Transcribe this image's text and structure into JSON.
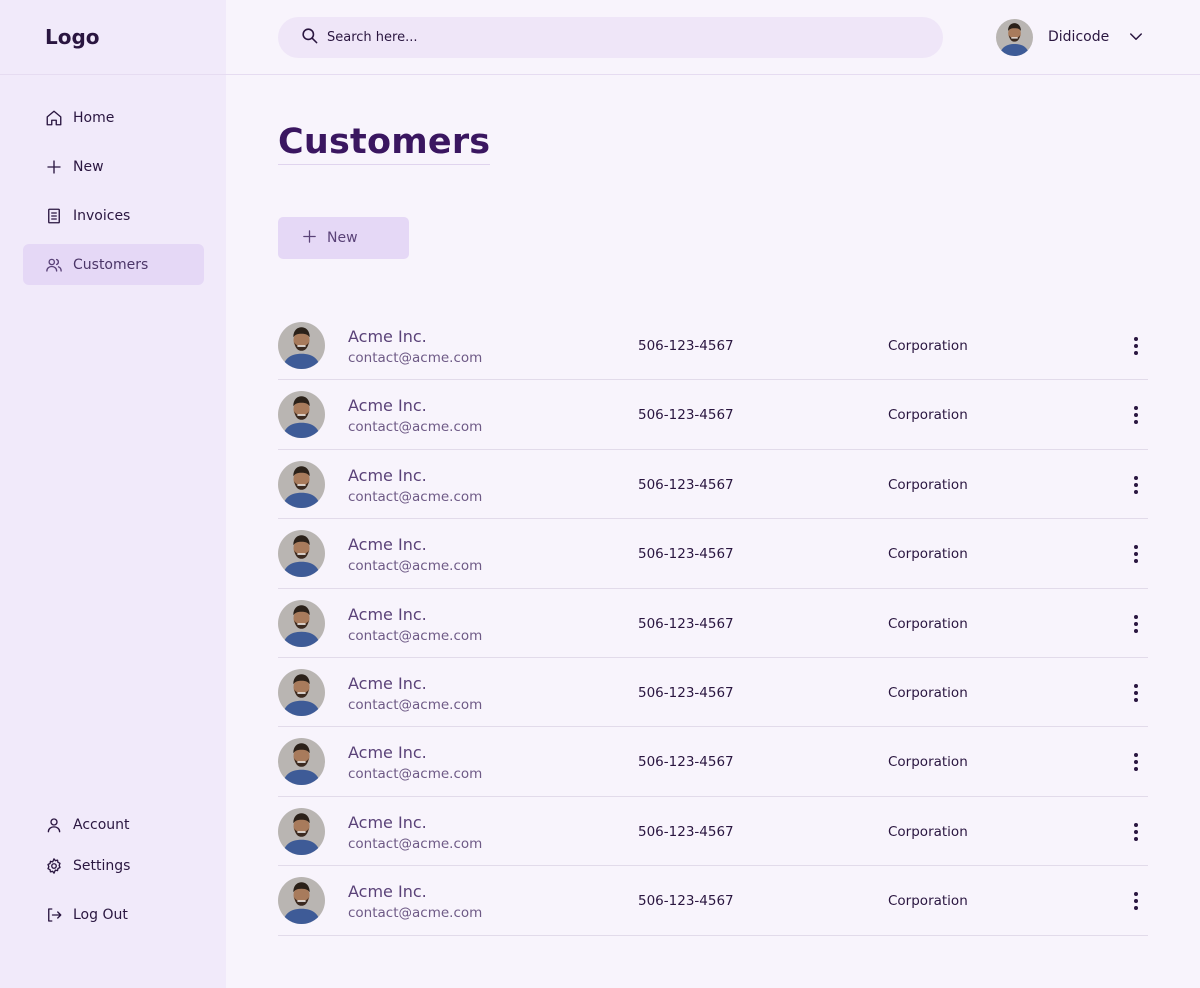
{
  "sidebar": {
    "logo": "Logo",
    "nav": [
      {
        "label": "Home",
        "icon": "home-icon"
      },
      {
        "label": "New",
        "icon": "plus-icon"
      },
      {
        "label": "Invoices",
        "icon": "document-icon"
      },
      {
        "label": "Customers",
        "icon": "users-icon",
        "active": true
      }
    ],
    "bottom": [
      {
        "label": "Account",
        "icon": "user-icon"
      },
      {
        "label": "Settings",
        "icon": "gear-icon"
      },
      {
        "label": "Log Out",
        "icon": "logout-icon"
      }
    ]
  },
  "header": {
    "search_placeholder": "Search here...",
    "user_name": "Didicode"
  },
  "main": {
    "title": "Customers",
    "new_button_label": "New",
    "customers": [
      {
        "name": "Acme Inc.",
        "email": "contact@acme.com",
        "phone": "506-123-4567",
        "type": "Corporation"
      },
      {
        "name": "Acme Inc.",
        "email": "contact@acme.com",
        "phone": "506-123-4567",
        "type": "Corporation"
      },
      {
        "name": "Acme Inc.",
        "email": "contact@acme.com",
        "phone": "506-123-4567",
        "type": "Corporation"
      },
      {
        "name": "Acme Inc.",
        "email": "contact@acme.com",
        "phone": "506-123-4567",
        "type": "Corporation"
      },
      {
        "name": "Acme Inc.",
        "email": "contact@acme.com",
        "phone": "506-123-4567",
        "type": "Corporation"
      },
      {
        "name": "Acme Inc.",
        "email": "contact@acme.com",
        "phone": "506-123-4567",
        "type": "Corporation"
      },
      {
        "name": "Acme Inc.",
        "email": "contact@acme.com",
        "phone": "506-123-4567",
        "type": "Corporation"
      },
      {
        "name": "Acme Inc.",
        "email": "contact@acme.com",
        "phone": "506-123-4567",
        "type": "Corporation"
      },
      {
        "name": "Acme Inc.",
        "email": "contact@acme.com",
        "phone": "506-123-4567",
        "type": "Corporation"
      }
    ]
  },
  "colors": {
    "background": "#f8f4fc",
    "sidebar": "#f1eafa",
    "accent": "#e5d8f6",
    "title": "#3a1660"
  }
}
